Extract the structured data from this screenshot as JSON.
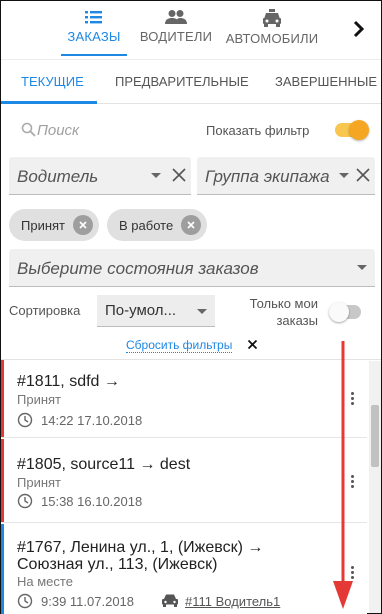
{
  "top_nav": {
    "items": [
      {
        "label": "ЗАКАЗЫ",
        "icon": "list-icon",
        "active": true
      },
      {
        "label": "ВОДИТЕЛИ",
        "icon": "people-icon",
        "active": false
      },
      {
        "label": "АВТОМОБИЛИ",
        "icon": "taxi-icon",
        "active": false
      }
    ],
    "accent": "#1e88e5"
  },
  "sub_tabs": [
    {
      "label": "ТЕКУЩИЕ",
      "active": true
    },
    {
      "label": "ПРЕДВАРИТЕЛЬНЫЕ",
      "active": false
    },
    {
      "label": "ЗАВЕРШЕННЫЕ",
      "active": false
    }
  ],
  "search": {
    "placeholder": "Поиск",
    "value": "",
    "show_filter_label": "Показать фильтр",
    "show_filter_on": true
  },
  "filters": {
    "driver_placeholder": "Водитель",
    "crew_group_placeholder": "Группа экипажа",
    "status_chips": [
      "Принят",
      "В работе"
    ],
    "status_placeholder": "Выберите состояния заказов",
    "sort_label": "Сортировка",
    "sort_value": "По-умол...",
    "only_mine_label": "Только мои заказы",
    "only_mine_on": false,
    "reset_label": "Сбросить фильтры"
  },
  "orders": [
    {
      "title_lines": [
        "#1811, sdfd →"
      ],
      "status": "Принят",
      "time": "14:22 17.10.2018",
      "driver": "",
      "stripe_color": "#e53935"
    },
    {
      "title_lines": [
        "#1805, source11 → dest"
      ],
      "status": "Принят",
      "time": "15:38 16.10.2018",
      "driver": "",
      "stripe_color": "#e53935"
    },
    {
      "title_lines": [
        "#1767, Ленина ул., 1, (Ижевск) →",
        "Союзная ул., 113, (Ижевск)"
      ],
      "status": "На месте",
      "time": "9:39 11.07.2018",
      "driver": "#111 Водитель1",
      "stripe_color": "#1e88e5"
    }
  ],
  "colors": {
    "toggle_on": "#f5a623",
    "annotation_arrow": "#e53935"
  }
}
